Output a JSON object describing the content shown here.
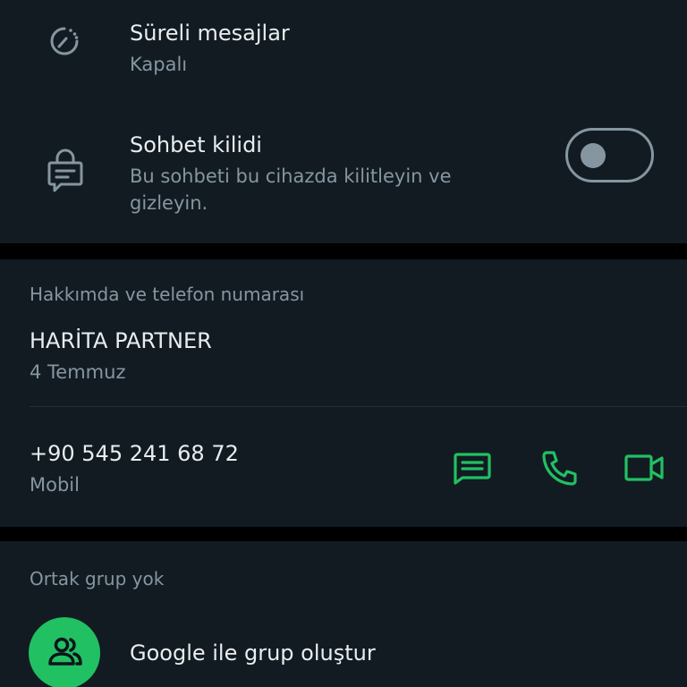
{
  "disappearing": {
    "title": "Süreli mesajlar",
    "value": "Kapalı",
    "icon": "timer-icon"
  },
  "chat_lock": {
    "title": "Sohbet kilidi",
    "description": "Bu sohbeti bu cihazda kilitleyin ve gizleyin.",
    "icon": "chat-lock-icon",
    "toggle_on": false
  },
  "about": {
    "section_label": "Hakkımda ve telefon numarası",
    "about_text": "HARİTA PARTNER",
    "about_date": "4 Temmuz",
    "phone": "+90 545 241 68 72",
    "phone_type": "Mobil",
    "actions": [
      "message-icon",
      "call-icon",
      "video-call-icon"
    ]
  },
  "groups": {
    "section_label": "Ortak grup yok",
    "create_label": "Google ile grup oluştur",
    "icon": "group-icon"
  },
  "colors": {
    "background": "#121b22",
    "separator": "#000000",
    "accent": "#21c063",
    "primary_text": "#e9edef",
    "secondary_text": "#8696a0"
  }
}
